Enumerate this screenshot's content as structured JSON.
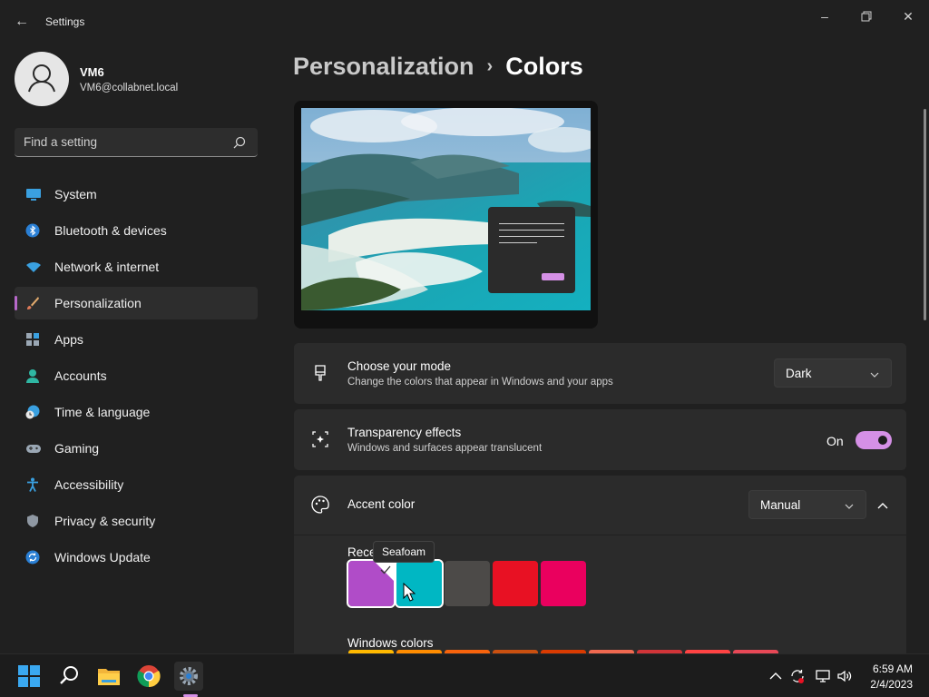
{
  "window": {
    "title": "Settings",
    "back_icon": "back-arrow-icon",
    "controls": [
      "minimize-icon",
      "restore-icon",
      "close-icon"
    ]
  },
  "user": {
    "name": "VM6",
    "email": "VM6@collabnet.local"
  },
  "search": {
    "placeholder": "Find a setting"
  },
  "sidebar": {
    "items": [
      {
        "label": "System",
        "icon": "system-icon"
      },
      {
        "label": "Bluetooth & devices",
        "icon": "bluetooth-icon"
      },
      {
        "label": "Network & internet",
        "icon": "wifi-icon"
      },
      {
        "label": "Personalization",
        "icon": "brush-icon",
        "active": true
      },
      {
        "label": "Apps",
        "icon": "apps-icon"
      },
      {
        "label": "Accounts",
        "icon": "accounts-icon"
      },
      {
        "label": "Time & language",
        "icon": "clock-globe-icon"
      },
      {
        "label": "Gaming",
        "icon": "gamepad-icon"
      },
      {
        "label": "Accessibility",
        "icon": "accessibility-icon"
      },
      {
        "label": "Privacy & security",
        "icon": "shield-icon"
      },
      {
        "label": "Windows Update",
        "icon": "update-icon"
      }
    ]
  },
  "breadcrumb": {
    "parent": "Personalization",
    "separator": "›",
    "current": "Colors"
  },
  "mode_card": {
    "title": "Choose your mode",
    "description": "Change the colors that appear in Windows and your apps",
    "value": "Dark"
  },
  "transparency_card": {
    "title": "Transparency effects",
    "description": "Windows and surfaces appear translucent",
    "state": "On",
    "on": true
  },
  "accent_card": {
    "title": "Accent color",
    "value": "Manual",
    "expanded": true
  },
  "recent_colors": {
    "label": "Rece",
    "tooltip": "Seafoam",
    "swatches": [
      {
        "color": "#b04cc8",
        "selected": true
      },
      {
        "color": "#00b7c3"
      },
      {
        "color": "#4c4a48"
      },
      {
        "color": "#e81123"
      },
      {
        "color": "#ea005e"
      }
    ]
  },
  "windows_colors": {
    "label": "Windows colors",
    "swatches": [
      "#ffb900",
      "#ff8c00",
      "#f7630c",
      "#ca5010",
      "#da3b01",
      "#ef6950",
      "#d13438",
      "#ff4343",
      "#e74856"
    ]
  },
  "colors": {
    "accent": "#d590e6",
    "background": "#202020",
    "card": "#2b2b2b"
  },
  "taskbar": {
    "apps": [
      "start-icon",
      "search-icon",
      "file-explorer-icon",
      "chrome-icon",
      "settings-icon"
    ],
    "tray": [
      "chevron-up-icon",
      "sync-icon",
      "network-icon",
      "volume-icon"
    ],
    "time": "6:59 AM",
    "date": "2/4/2023"
  }
}
